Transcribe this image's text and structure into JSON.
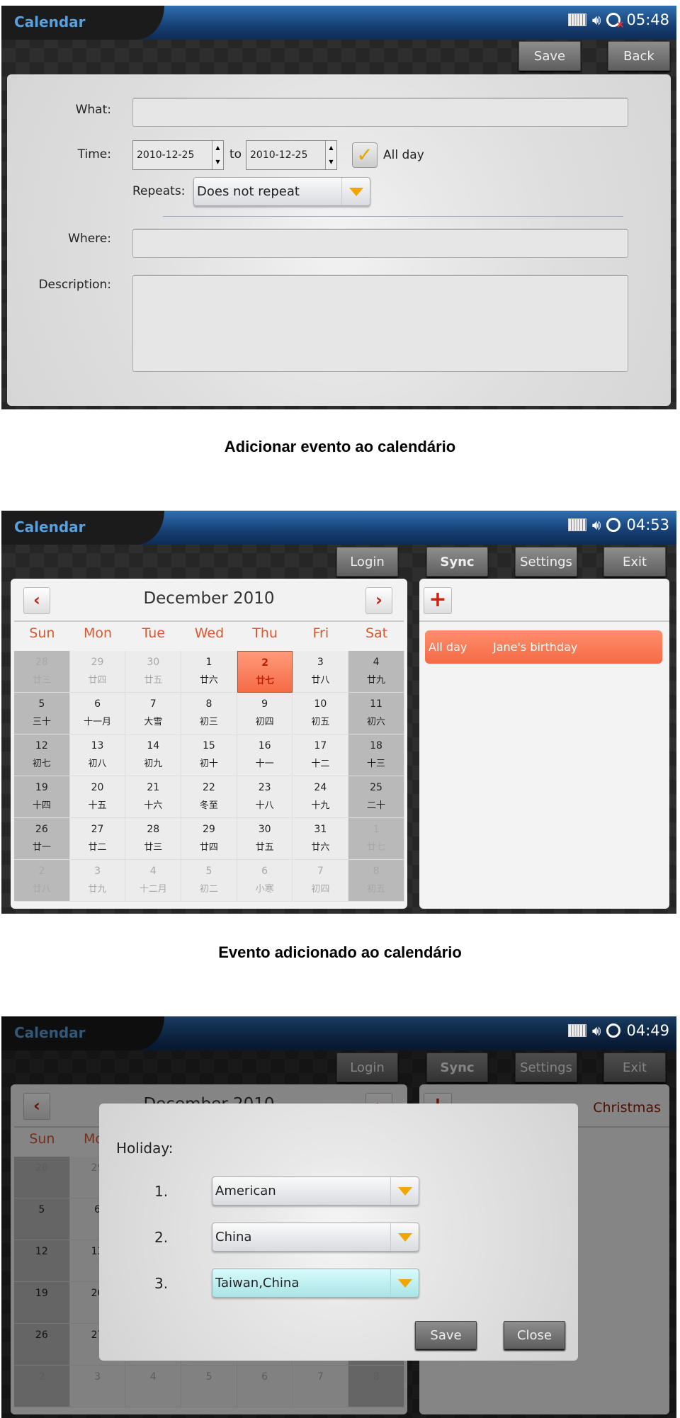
{
  "screen1": {
    "app_title": "Calendar",
    "time": "05:48",
    "save": "Save",
    "back": "Back",
    "what_label": "What:",
    "time_label": "Time:",
    "start_date": "2010-12-25",
    "to": "to",
    "end_date": "2010-12-25",
    "all_day": "All day",
    "all_day_checked": true,
    "repeats_label": "Repeats:",
    "repeats_value": "Does not repeat",
    "where_label": "Where:",
    "description_label": "Description:",
    "what_value": "",
    "where_value": "",
    "description_value": ""
  },
  "caption1": "Adicionar evento ao calendário",
  "screen2": {
    "app_title": "Calendar",
    "time": "04:53",
    "buttons": [
      "Login",
      "Sync",
      "Settings",
      "Exit"
    ],
    "month": "December  2010",
    "event": {
      "time": "All day",
      "title": "Jane's birthday"
    }
  },
  "caption2": "Evento adicionado ao calendário",
  "screen3": {
    "app_title": "Calendar",
    "time": "04:49",
    "buttons": [
      "Login",
      "Sync",
      "Settings",
      "Exit"
    ],
    "event_header": "Christmas",
    "dialog": {
      "title": "Holiday:",
      "rows": [
        {
          "num": "1.",
          "value": "American"
        },
        {
          "num": "2.",
          "value": "China"
        },
        {
          "num": "3.",
          "value": "Taiwan,China",
          "highlighted": true
        }
      ],
      "save": "Save",
      "close": "Close"
    }
  },
  "calendar": {
    "weekdays": [
      "Sun",
      "Mon",
      "Tue",
      "Wed",
      "Thu",
      "Fri",
      "Sat"
    ],
    "weeks": [
      [
        {
          "d": "28",
          "l": "廿三",
          "m": true
        },
        {
          "d": "29",
          "l": "廿四",
          "m": true
        },
        {
          "d": "30",
          "l": "廿五",
          "m": true
        },
        {
          "d": "1",
          "l": "廿六"
        },
        {
          "d": "2",
          "l": "廿七",
          "sel": true
        },
        {
          "d": "3",
          "l": "廿八"
        },
        {
          "d": "4",
          "l": "廿九"
        }
      ],
      [
        {
          "d": "5",
          "l": "三十"
        },
        {
          "d": "6",
          "l": "十一月"
        },
        {
          "d": "7",
          "l": "大雪"
        },
        {
          "d": "8",
          "l": "初三"
        },
        {
          "d": "9",
          "l": "初四"
        },
        {
          "d": "10",
          "l": "初五"
        },
        {
          "d": "11",
          "l": "初六"
        }
      ],
      [
        {
          "d": "12",
          "l": "初七"
        },
        {
          "d": "13",
          "l": "初八"
        },
        {
          "d": "14",
          "l": "初九"
        },
        {
          "d": "15",
          "l": "初十"
        },
        {
          "d": "16",
          "l": "十一"
        },
        {
          "d": "17",
          "l": "十二"
        },
        {
          "d": "18",
          "l": "十三"
        }
      ],
      [
        {
          "d": "19",
          "l": "十四"
        },
        {
          "d": "20",
          "l": "十五"
        },
        {
          "d": "21",
          "l": "十六"
        },
        {
          "d": "22",
          "l": "冬至"
        },
        {
          "d": "23",
          "l": "十八"
        },
        {
          "d": "24",
          "l": "十九"
        },
        {
          "d": "25",
          "l": "二十"
        }
      ],
      [
        {
          "d": "26",
          "l": "廿一"
        },
        {
          "d": "27",
          "l": "廿二"
        },
        {
          "d": "28",
          "l": "廿三"
        },
        {
          "d": "29",
          "l": "廿四"
        },
        {
          "d": "30",
          "l": "廿五"
        },
        {
          "d": "31",
          "l": "廿六"
        },
        {
          "d": "1",
          "l": "廿七",
          "m": true
        }
      ],
      [
        {
          "d": "2",
          "l": "廿八",
          "m": true
        },
        {
          "d": "3",
          "l": "廿九",
          "m": true
        },
        {
          "d": "4",
          "l": "十二月",
          "m": true
        },
        {
          "d": "5",
          "l": "初二",
          "m": true
        },
        {
          "d": "6",
          "l": "小寒",
          "m": true
        },
        {
          "d": "7",
          "l": "初四",
          "m": true
        },
        {
          "d": "8",
          "l": "初五",
          "m": true
        }
      ]
    ]
  },
  "colors": {
    "accent_orange": "#f56a45",
    "title_blue": "#5aa0dc",
    "weekday_red": "#d9582e",
    "highlight_cyan": "#a9e4e6"
  },
  "icons": {
    "status": [
      "keyboard-icon",
      "speaker-icon",
      "sync-icon"
    ],
    "nav": [
      "chevron-left-icon",
      "chevron-right-icon"
    ],
    "add": "plus-icon",
    "dropdown": "triangle-down-icon",
    "check": "checkmark-icon"
  }
}
